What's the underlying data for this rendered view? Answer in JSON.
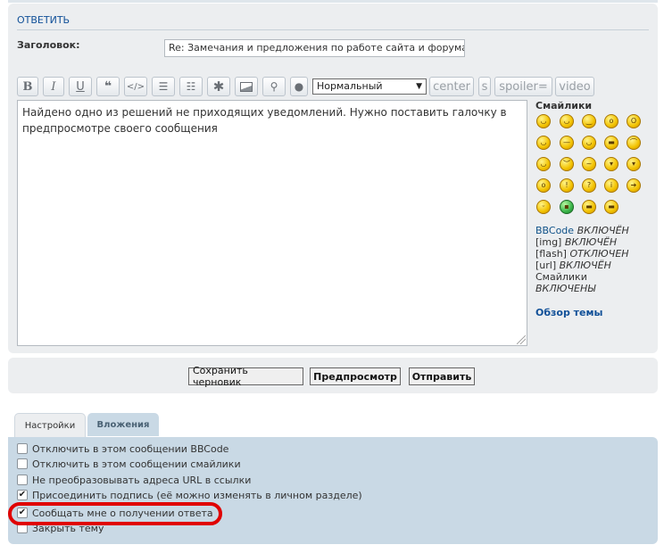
{
  "reply": {
    "section_title": "ОТВЕТИТЬ",
    "subject_label": "Заголовок:",
    "subject_value": "Re: Замечания и предложения по работе сайта и форума"
  },
  "toolbar": {
    "bold": "B",
    "italic": "I",
    "underline": "U",
    "quote_icon": "quote-icon",
    "code_icon": "code-icon",
    "list_icon": "list-icon",
    "ordered_list_icon": "ordered-list-icon",
    "list_item_icon": "asterisk-icon",
    "image_icon": "image-icon",
    "url_icon": "link-icon",
    "color_icon": "color-drop-icon",
    "font_size_selected": "Нормальный",
    "custom_tags": [
      "center",
      "s",
      "spoiler=",
      "video"
    ]
  },
  "message": {
    "text": "Найдено одно из решений не приходящих уведомлений. Нужно поставить галочку в предпросмотре своего сообщения"
  },
  "sidebar": {
    "smilies_title": "Смайлики",
    "bbcode_link": "BBCode",
    "bbcode_status": "ВКЛЮЧЁН",
    "img_label": "[img]",
    "img_status": "ВКЛЮЧЁН",
    "flash_label": "[flash]",
    "flash_status": "ОТКЛЮЧЕН",
    "url_label": "[url]",
    "url_status": "ВКЛЮЧЁН",
    "smilies_label": "Смайлики",
    "smilies_status": "ВКЛЮЧЕНЫ",
    "topic_review": "Обзор темы"
  },
  "buttons": {
    "save_draft": "Сохранить черновик",
    "preview": "Предпросмотр",
    "submit": "Отправить"
  },
  "tabs": {
    "options": "Настройки",
    "attachments": "Вложения"
  },
  "options": [
    {
      "label": "Отключить в этом сообщении BBCode",
      "checked": false
    },
    {
      "label": "Отключить в этом сообщении смайлики",
      "checked": false
    },
    {
      "label": "Не преобразовывать адреса URL в ссылки",
      "checked": false
    },
    {
      "label": "Присоединить подпись (её можно изменять в личном разделе)",
      "checked": true
    },
    {
      "label": "Сообщать мне о получении ответа",
      "checked": true
    },
    {
      "label": "Закрыть тему",
      "checked": false
    }
  ],
  "colors": {
    "highlight": "#e00000",
    "link": "#105289",
    "panel": "#eceef0",
    "options_panel": "#c9d9e5"
  }
}
